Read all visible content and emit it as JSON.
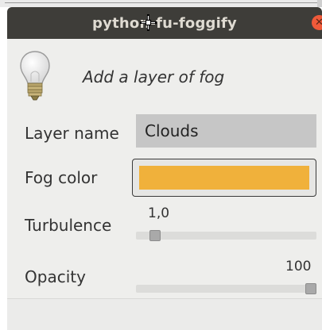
{
  "window": {
    "title": "python-fu-foggify",
    "close_icon": "close-icon",
    "cursor_icon": "crosshair-move-cursor-icon"
  },
  "header": {
    "icon": "lightbulb-icon",
    "text": "Add a layer of fog"
  },
  "fields": {
    "layer_name": {
      "label": "Layer name",
      "value": "Clouds"
    },
    "fog_color": {
      "label": "Fog color",
      "value": "#f0b13b"
    },
    "turbulence": {
      "label": "Turbulence",
      "value": "1,0",
      "fraction": 0.08
    },
    "opacity": {
      "label": "Opacity",
      "value": "100",
      "fraction": 1.0
    }
  },
  "colors": {
    "titlebar": "#3e3d39",
    "title_text": "#dfdbd2",
    "close_button": "#ef5a3a",
    "panel_bg": "#eeeeec",
    "accent_fog": "#f0b13b"
  }
}
